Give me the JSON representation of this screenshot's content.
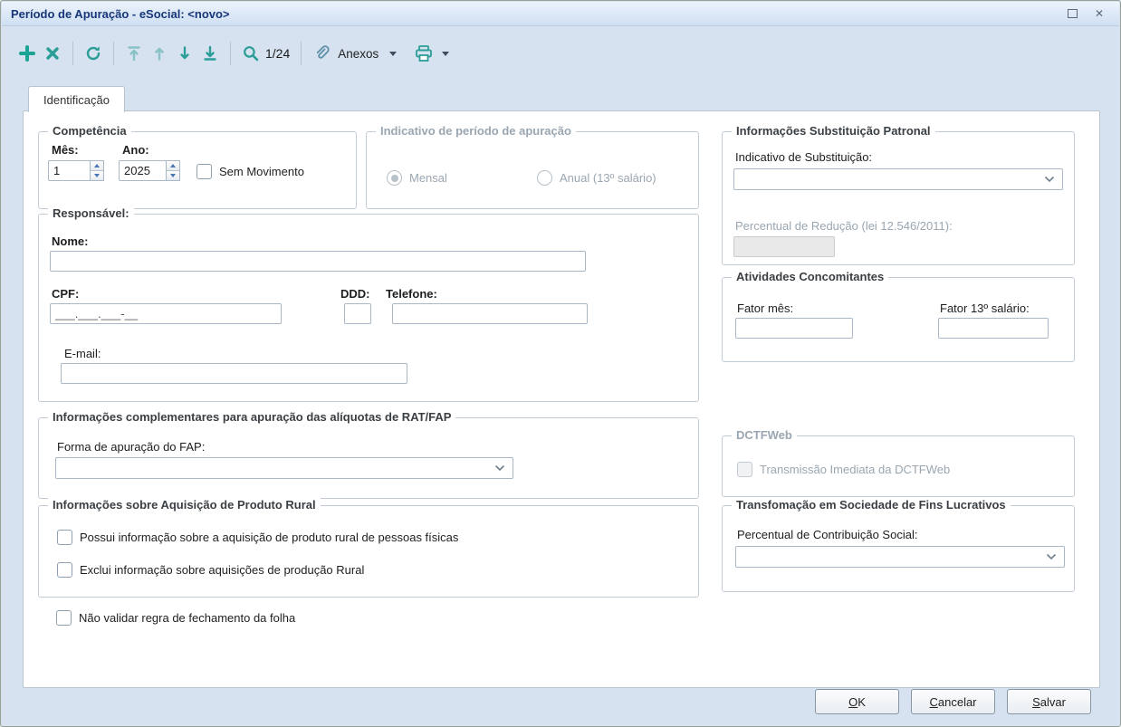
{
  "window": {
    "title": "Período de Apuração - eSocial: <novo>"
  },
  "toolbar": {
    "counter": "1/24",
    "anexos_label": "Anexos",
    "icons": [
      "add-icon",
      "delete-icon",
      "refresh-icon",
      "first-record-icon",
      "previous-record-icon",
      "next-record-icon",
      "last-record-icon",
      "search-icon",
      "paperclip-icon",
      "printer-icon"
    ]
  },
  "tabs": [
    {
      "label": "Identificação"
    }
  ],
  "competencia": {
    "title": "Competência",
    "mes_label": "Mês:",
    "ano_label": "Ano:",
    "mes_value": "1",
    "ano_value": "2025",
    "sem_movimento_label": "Sem Movimento"
  },
  "indicativo_periodo": {
    "title": "Indicativo de período de apuração",
    "mensal_label": "Mensal",
    "anual_label": "Anual (13º salário)"
  },
  "substituicao": {
    "title": "Informações Substituição Patronal",
    "indicativo_label": "Indicativo de Substituição:",
    "percentual_label": "Percentual de Redução  (lei 12.546/2011):"
  },
  "responsavel": {
    "title": "Responsável:",
    "nome_label": "Nome:",
    "cpf_label": "CPF:",
    "cpf_mask": "___.___.___-__",
    "ddd_label": "DDD:",
    "telefone_label": "Telefone:",
    "email_label": "E-mail:"
  },
  "atividades": {
    "title": "Atividades Concomitantes",
    "fator_mes_label": "Fator mês:",
    "fator_13_label": "Fator 13º salário:"
  },
  "ratfap": {
    "title": "Informações complementares para apuração das alíquotas de RAT/FAP",
    "forma_label": "Forma de apuração do FAP:"
  },
  "dctfweb": {
    "title": "DCTFWeb",
    "transmissao_label": "Transmissão Imediata da DCTFWeb"
  },
  "aquisicao": {
    "title": "Informações sobre Aquisição de Produto Rural",
    "possui_label": "Possui informação sobre a aquisição de produto rural de pessoas físicas",
    "exclui_label": "Exclui informação sobre aquisições de produção Rural"
  },
  "transformacao": {
    "title": "Transfomação em Sociedade de Fins Lucrativos",
    "percentual_label": "Percentual de Contribuição Social:"
  },
  "nao_validar_label": "Não validar regra de fechamento da folha",
  "footer": {
    "ok": "OK",
    "cancelar": "Cancelar",
    "salvar": "Salvar"
  },
  "colors": {
    "accent_teal": "#2a9d97",
    "title_navy": "#17377a",
    "disabled_gray": "#9aa6b1"
  }
}
